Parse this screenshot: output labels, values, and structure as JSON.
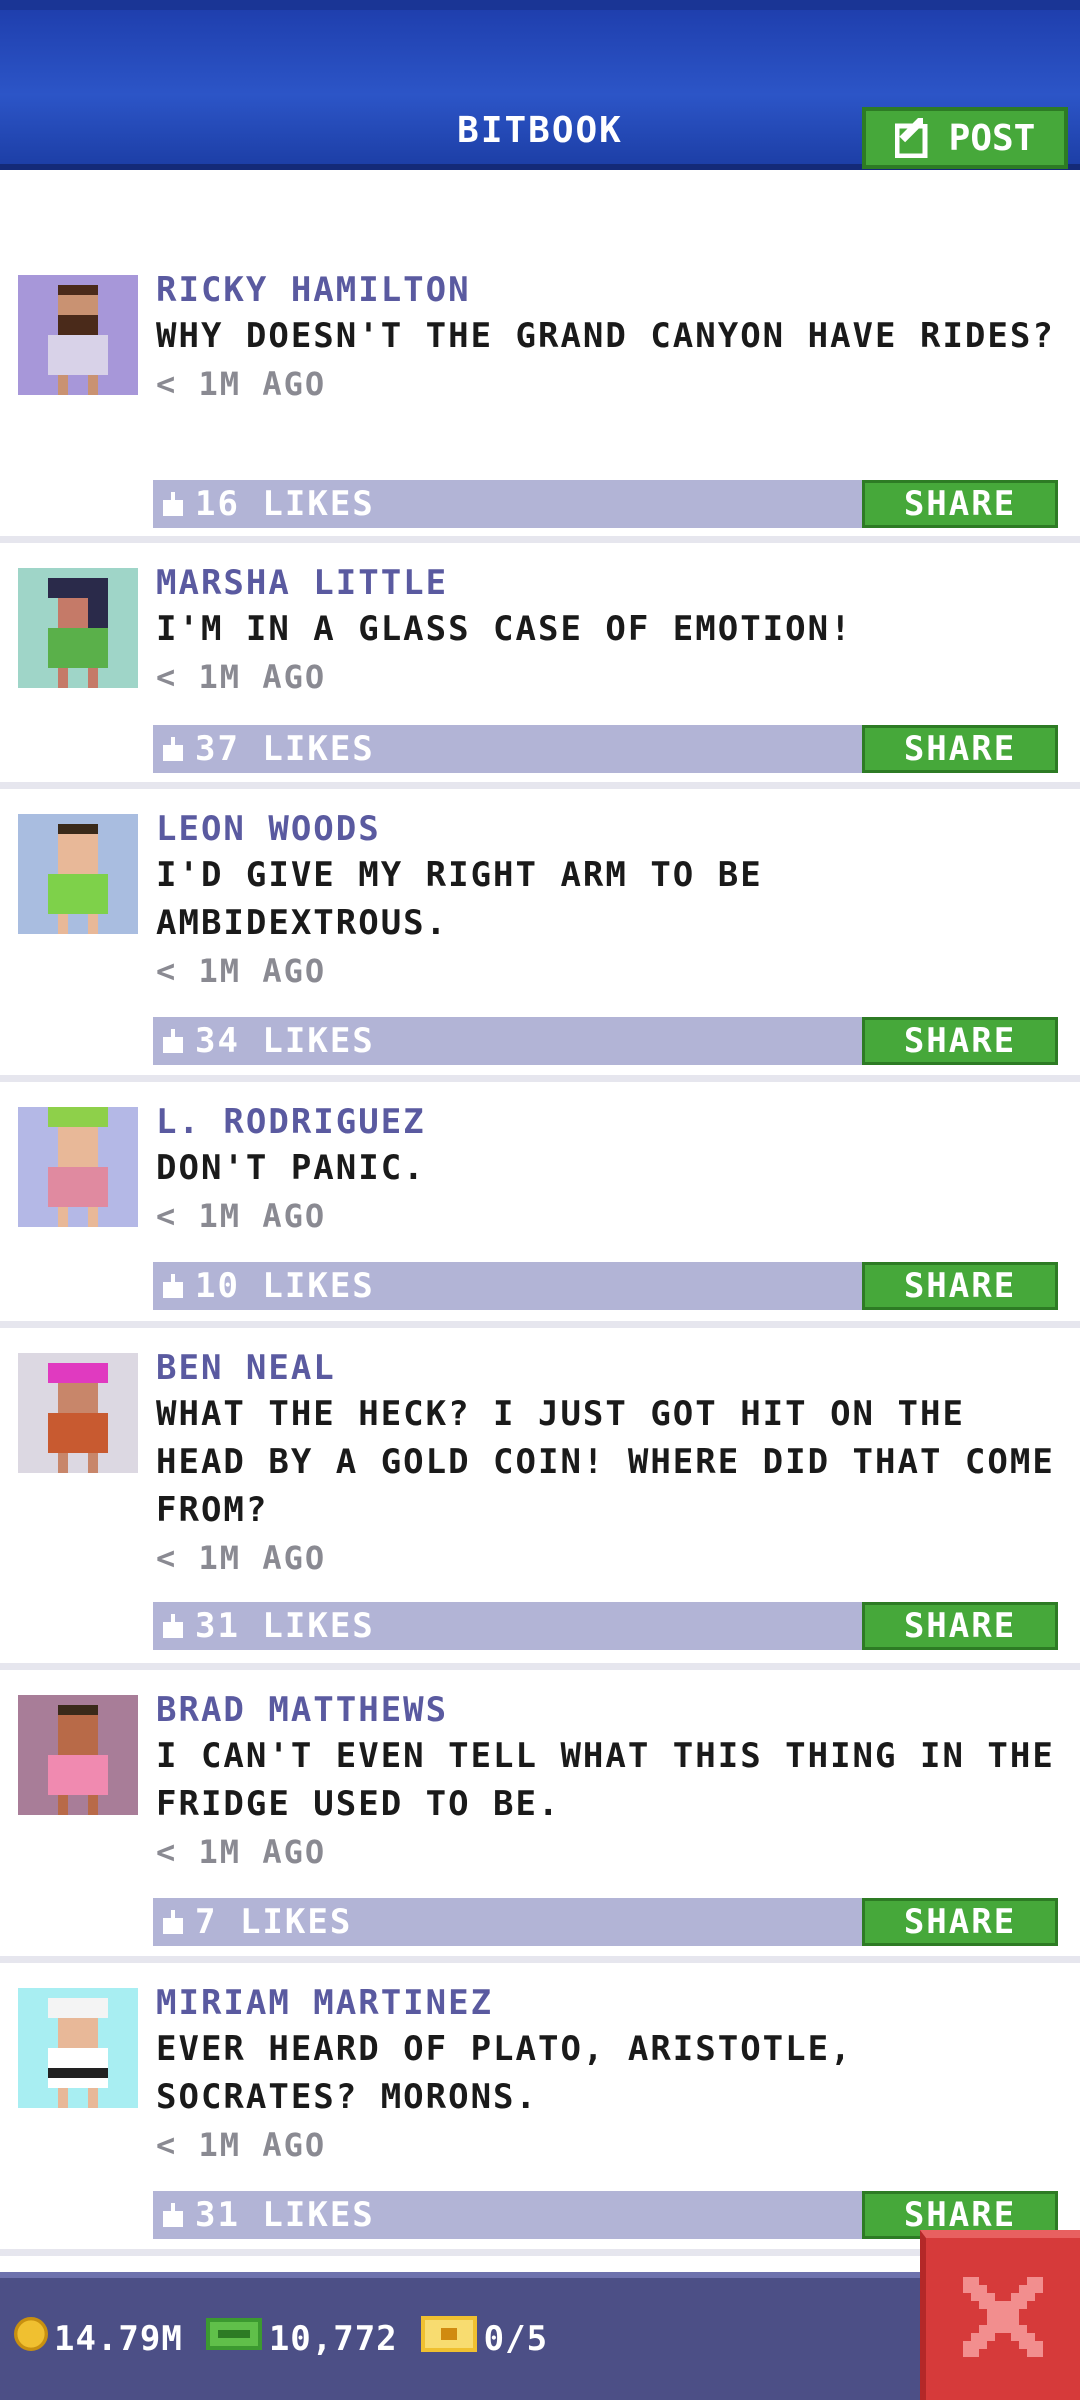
{
  "header": {
    "title": "BITBOOK",
    "post_label": "POST"
  },
  "colors": {
    "header_blue": "#2c55c7",
    "accent_green": "#46a83a",
    "like_bar": "#b2b4d6",
    "author": "#5a5aa0",
    "close_red": "#d63a3a",
    "footer": "#4c4f86"
  },
  "posts": [
    {
      "author": "RICKY HAMILTON",
      "message": "WHY DOESN'T THE GRAND CANYON HAVE RIDES?",
      "time": "< 1M AGO",
      "likes": "16 LIKES",
      "share": "SHARE",
      "avatar_bg": "#a797d9"
    },
    {
      "author": "MARSHA LITTLE",
      "message": "I'M IN A GLASS CASE OF EMOTION!",
      "time": "< 1M AGO",
      "likes": "37 LIKES",
      "share": "SHARE",
      "avatar_bg": "#9fd5c8"
    },
    {
      "author": "LEON WOODS",
      "message": "I'D GIVE MY RIGHT ARM TO BE AMBIDEXTROUS.",
      "time": "< 1M AGO",
      "likes": "34 LIKES",
      "share": "SHARE",
      "avatar_bg": "#a9bde0"
    },
    {
      "author": "L. RODRIGUEZ",
      "message": "DON'T PANIC.",
      "time": "< 1M AGO",
      "likes": "10 LIKES",
      "share": "SHARE",
      "avatar_bg": "#b4b8e6"
    },
    {
      "author": "BEN NEAL",
      "message": "WHAT THE HECK? I JUST GOT HIT ON THE HEAD BY A GOLD COIN! WHERE DID THAT COME FROM?",
      "time": "< 1M AGO",
      "likes": "31 LIKES",
      "share": "SHARE",
      "avatar_bg": "#dcd8e2"
    },
    {
      "author": "BRAD MATTHEWS",
      "message": "I CAN'T EVEN TELL WHAT THIS THING IN THE FRIDGE USED TO BE.",
      "time": "< 1M AGO",
      "likes": "7 LIKES",
      "share": "SHARE",
      "avatar_bg": "#a87d98"
    },
    {
      "author": "MIRIAM MARTINEZ",
      "message": "EVER HEARD OF PLATO, ARISTOTLE, SOCRATES? MORONS.",
      "time": "< 1M AGO",
      "likes": "31 LIKES",
      "share": "SHARE",
      "avatar_bg": "#a8eef2"
    }
  ],
  "footer": {
    "coins": "14.79M",
    "bux": "10,772",
    "tickets": "0/5"
  }
}
